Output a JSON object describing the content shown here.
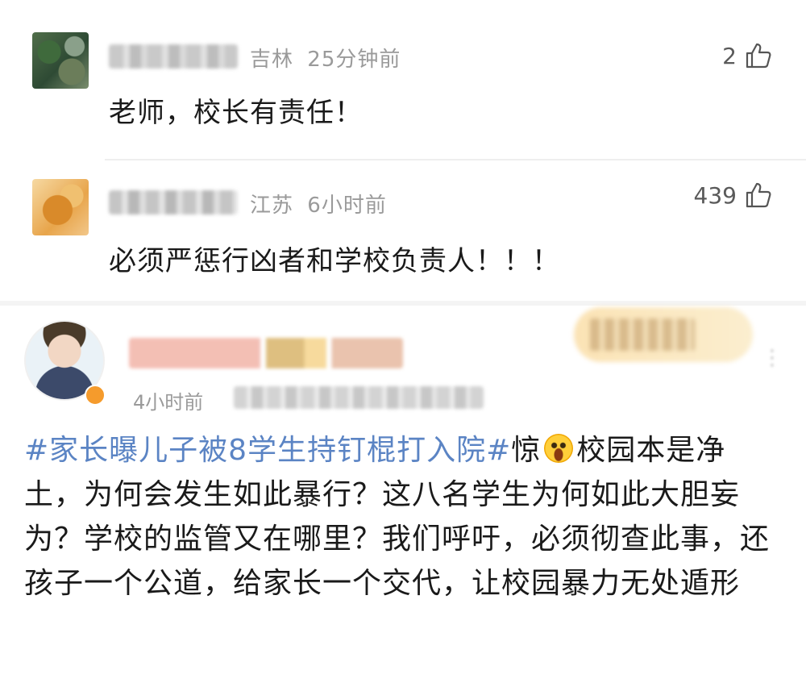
{
  "comments": [
    {
      "location": "吉林",
      "time": "25分钟前",
      "likes": "2",
      "text": "老师，校长有责任！",
      "icon": "thumbs-up-icon"
    },
    {
      "location": "江苏",
      "time": "6小时前",
      "likes": "439",
      "text": "必须严惩行凶者和学校负责人！！！",
      "icon": "thumbs-up-icon"
    }
  ],
  "post": {
    "time": "4小时前",
    "topic": "#家长曝儿子被8学生持钉棍打入院#",
    "before_emoji": "惊",
    "emoji": "shocked-face-emoji",
    "body": "校园本是净土，为何会发生如此暴行？这八名学生为何如此大胆妄为？学校的监管又在哪里？我们呼吁，必须彻查此事，还孩子一个公道，给家长一个交代，让校园暴力无处遁形"
  },
  "colors": {
    "topic_link": "#5b84c4",
    "meta_gray": "#9a9a9a",
    "follow_bg": "#fbe3b5"
  }
}
